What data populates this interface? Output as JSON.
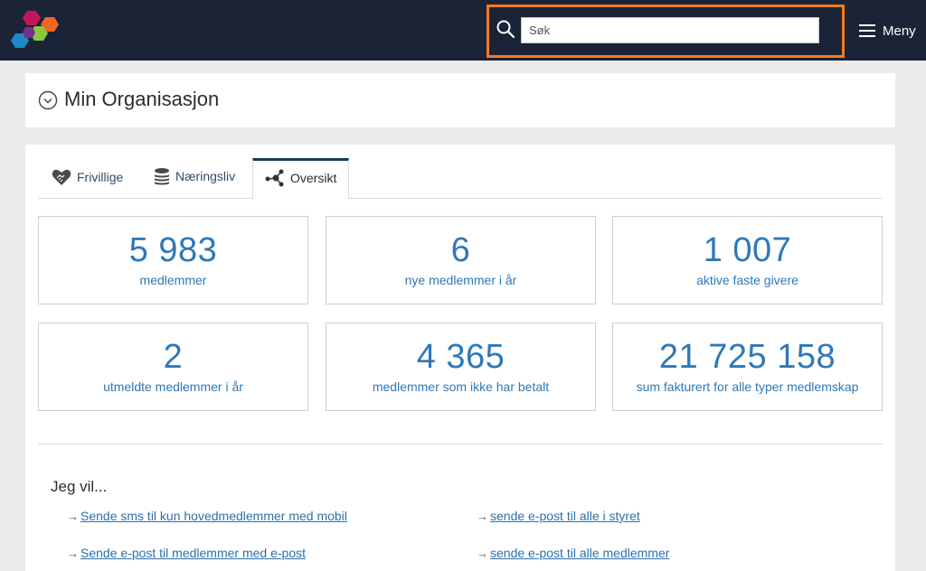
{
  "header": {
    "search_placeholder": "Søk",
    "menu_label": "Meny"
  },
  "org": {
    "title": "Min Organisasjon"
  },
  "tabs": [
    {
      "label": "Frivillige",
      "icon": "handshake-heart-icon"
    },
    {
      "label": "Næringsliv",
      "icon": "coin-stack-icon"
    },
    {
      "label": "Oversikt",
      "icon": "network-nodes-icon",
      "active": true
    }
  ],
  "stats": [
    {
      "value": "5 983",
      "label": "medlemmer"
    },
    {
      "value": "6",
      "label": "nye medlemmer i år"
    },
    {
      "value": "1 007",
      "label": "aktive faste givere"
    },
    {
      "value": "2",
      "label": "utmeldte medlemmer i år"
    },
    {
      "value": "4 365",
      "label": "medlemmer som ikke har betalt"
    },
    {
      "value": "21 725 158",
      "label": "sum fakturert for alle typer medlemskap"
    }
  ],
  "actions_heading": "Jeg vil...",
  "actions": [
    {
      "label": "Sende sms til kun hovedmedlemmer med mobil"
    },
    {
      "label": "sende e-post til alle i styret"
    },
    {
      "label": "Sende e-post til medlemmer med e-post"
    },
    {
      "label": "sende e-post til alle medlemmer"
    }
  ],
  "colors": {
    "header_bg": "#1b2337",
    "accent": "#2e78b8",
    "highlight": "#f47b20"
  }
}
